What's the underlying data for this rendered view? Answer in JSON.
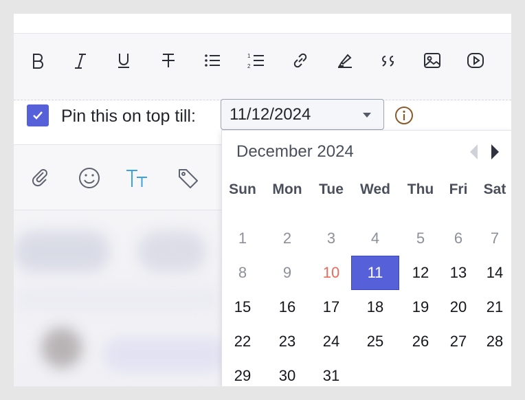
{
  "toolbar": {
    "icons": [
      "bold-icon",
      "italic-icon",
      "underline-icon",
      "strikethrough-icon",
      "bullet-list-icon",
      "numbered-list-icon",
      "link-icon",
      "highlighter-icon",
      "quote-icon",
      "image-icon",
      "video-icon"
    ]
  },
  "pin": {
    "checked": true,
    "label": "Pin this on top till:",
    "date_value": "11/12/2024"
  },
  "composer_bar": {
    "icons": [
      "attachment-icon",
      "emoji-icon",
      "text-format-icon",
      "tag-icon"
    ]
  },
  "calendar": {
    "month_label": "December 2024",
    "weekdays": [
      "Sun",
      "Mon",
      "Tue",
      "Wed",
      "Thu",
      "Fri",
      "Sat"
    ],
    "weeks": [
      [
        "1",
        "2",
        "3",
        "4",
        "5",
        "6",
        "7"
      ],
      [
        "8",
        "9",
        "10",
        "11",
        "12",
        "13",
        "14"
      ],
      [
        "15",
        "16",
        "17",
        "18",
        "19",
        "20",
        "21"
      ],
      [
        "22",
        "23",
        "24",
        "25",
        "26",
        "27",
        "28"
      ],
      [
        "29",
        "30",
        "31",
        "",
        "",
        "",
        ""
      ]
    ],
    "today": "10",
    "selected": "11",
    "disabled_until": "10"
  },
  "colors": {
    "accent": "#5660d8",
    "today": "#e86b5b",
    "info": "#8a5a2b",
    "text_link": "#3aa0e8"
  }
}
